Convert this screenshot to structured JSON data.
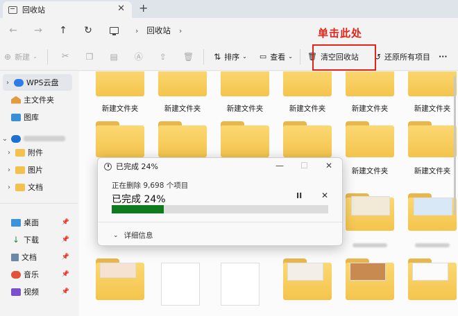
{
  "window": {
    "tab_title": "回收站",
    "close_glyph": "✕",
    "new_tab_glyph": "+"
  },
  "address": {
    "back": "←",
    "forward": "→",
    "up": "↑",
    "refresh": "↻",
    "location": "回收站",
    "sep": "›"
  },
  "annotation": "单击此处",
  "toolbar": {
    "new_label": "新建",
    "sort_label": "排序",
    "view_label": "查看",
    "empty_bin_label": "清空回收站",
    "restore_all_label": "还原所有项目",
    "more": "···"
  },
  "sidebar": {
    "items": [
      {
        "label": "WPS云盘",
        "icon": "cloud-icon"
      },
      {
        "label": "主文件夹",
        "icon": "home-icon"
      },
      {
        "label": "图库",
        "icon": "gallery-icon"
      },
      {
        "label": "",
        "icon": "onedrive-icon"
      },
      {
        "label": "附件",
        "icon": "folder-icon"
      },
      {
        "label": "图片",
        "icon": "folder-icon"
      },
      {
        "label": "文档",
        "icon": "folder-icon"
      },
      {
        "label": "桌面",
        "icon": "desktop-icon"
      },
      {
        "label": "下载",
        "icon": "download-icon"
      },
      {
        "label": "文档",
        "icon": "documents-icon"
      },
      {
        "label": "音乐",
        "icon": "music-icon"
      },
      {
        "label": "视频",
        "icon": "video-icon"
      }
    ]
  },
  "content": {
    "folder_label": "新建文件夹"
  },
  "dialog": {
    "title": "已完成 24%",
    "deleting_text": "正在删除 9,698 个项目",
    "progress_text": "已完成 24%",
    "progress": 0.24,
    "pause": "II",
    "close": "✕",
    "minimize": "—",
    "maximize": "☐",
    "details_label": "详细信息"
  },
  "colors": {
    "accent": "#0f7b1f",
    "annotation": "#e2231a",
    "folder": "#f6c94f"
  }
}
